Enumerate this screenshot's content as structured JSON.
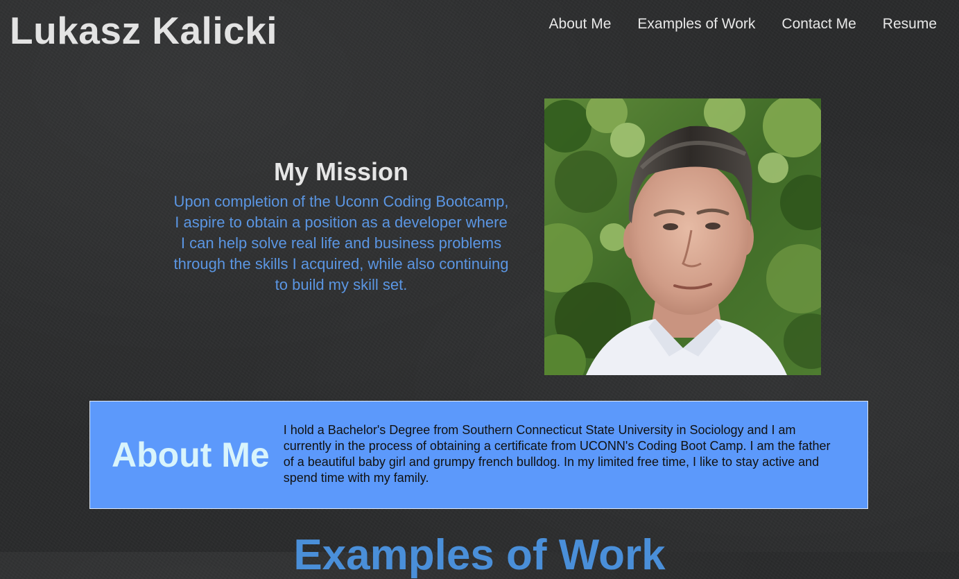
{
  "header": {
    "title": "Lukasz Kalicki",
    "nav": [
      "About Me",
      "Examples of Work",
      "Contact Me",
      "Resume"
    ]
  },
  "mission": {
    "heading": "My Mission",
    "text": "Upon completion of the Uconn Coding Bootcamp, I aspire to obtain a position as a developer where I can help solve real life and business problems through the skills I acquired, while also continuing to build my skill set."
  },
  "about": {
    "heading": "About Me",
    "text": "I hold a Bachelor's Degree from Southern Connecticut State University in Sociology and I am currently in the process of obtaining a certificate from UCONN's Coding Boot Camp. I am the father of a beautiful baby girl and grumpy french bulldog. In my limited free time, I like to stay active and spend time with my family."
  },
  "work": {
    "heading": "Examples of Work"
  },
  "colors": {
    "background": "#2a2b2c",
    "mission_text": "#5b96e3",
    "about_panel": "#5c99fb",
    "about_heading": "#d9f4fb",
    "work_heading": "#4a8fd9"
  },
  "icons": {
    "profile_photo": "portrait-photo"
  }
}
